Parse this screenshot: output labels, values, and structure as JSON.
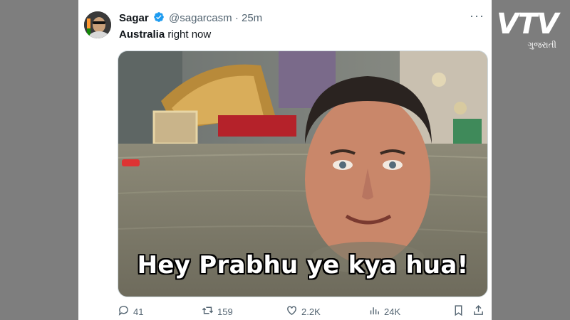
{
  "tweet": {
    "author_name": "Sagar",
    "handle": "@sagarcasm",
    "separator": "·",
    "time": "25m",
    "more_label": "···",
    "text_bold": "Australia",
    "text_rest": " right now",
    "media": {
      "caption": "Hey Prabhu ye kya hua!"
    },
    "actions": {
      "replies": "41",
      "retweets": "159",
      "likes": "2.2K",
      "views": "24K"
    }
  },
  "watermark": {
    "brand": "VTV",
    "subtitle": "ગુજરાતી"
  },
  "colors": {
    "verified": "#1d9bf0",
    "text_primary": "#0f1419",
    "text_secondary": "#536471",
    "frame": "#7e7e7e"
  },
  "icons": [
    "verified-badge-icon",
    "more-icon",
    "reply-icon",
    "retweet-icon",
    "like-icon",
    "views-icon",
    "bookmark-icon",
    "share-icon"
  ]
}
